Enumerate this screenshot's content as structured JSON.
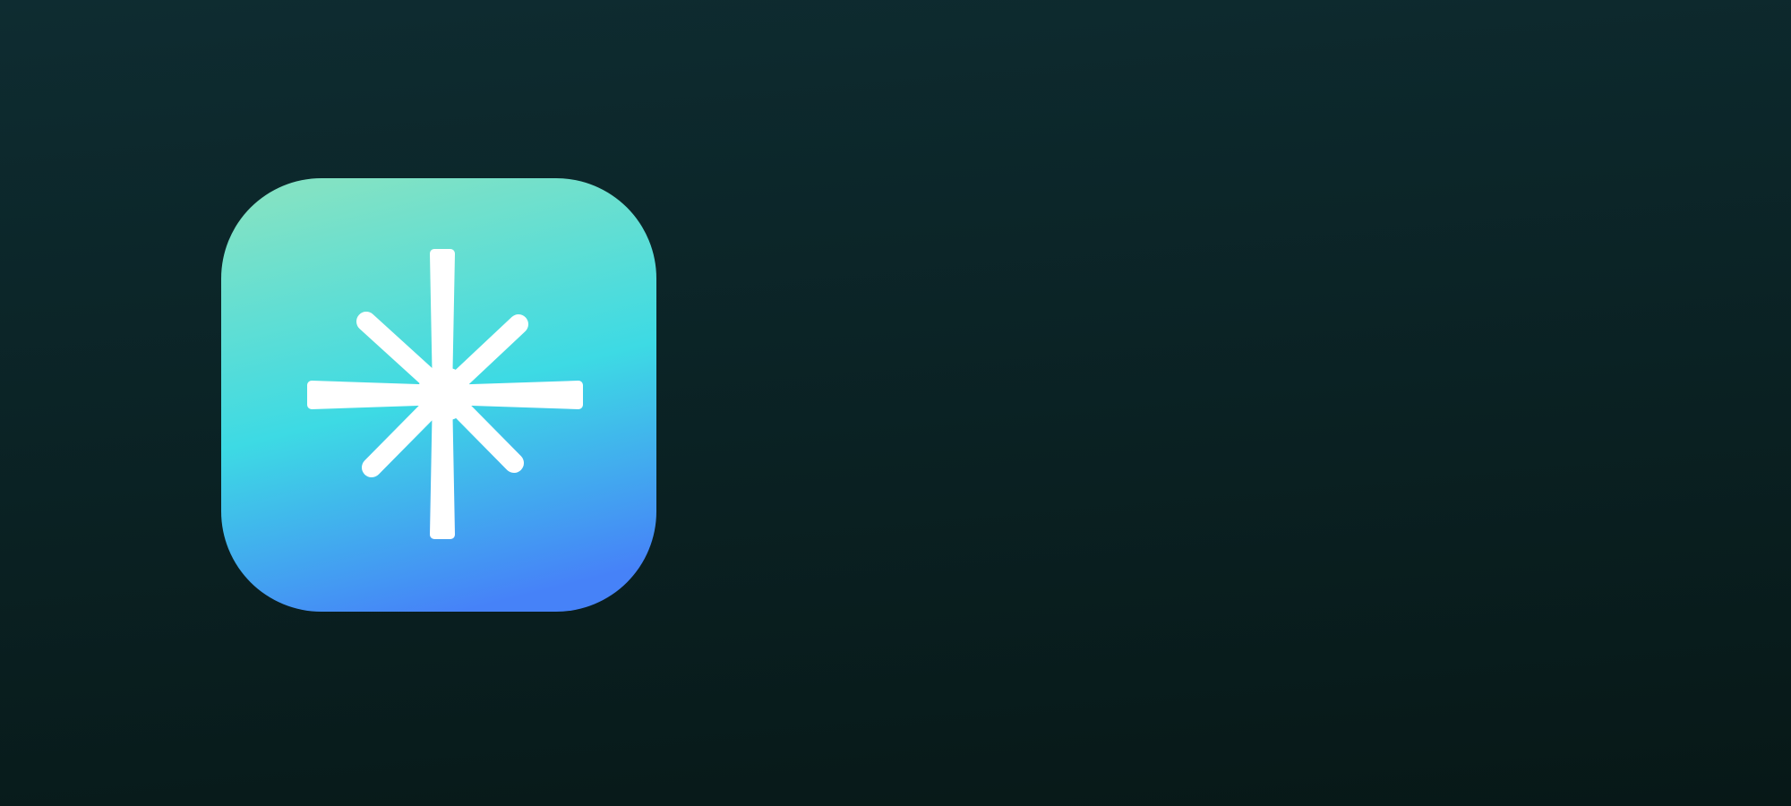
{
  "icon": {
    "name": "asterisk-star-icon",
    "colors": {
      "gradient_top": "#82e2c4",
      "gradient_middle": "#3ddae4",
      "gradient_bottom": "#4682f8",
      "glyph": "#ffffff",
      "background_top": "#0e2c31",
      "background_bottom": "#071817"
    }
  }
}
